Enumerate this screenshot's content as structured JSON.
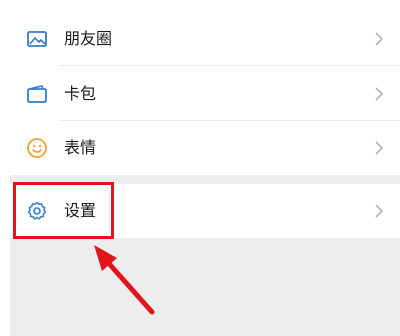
{
  "menu": {
    "items": [
      {
        "label": "朋友圈",
        "icon": "photo-album-icon"
      },
      {
        "label": "卡包",
        "icon": "card-wallet-icon"
      },
      {
        "label": "表情",
        "icon": "smiley-face-icon"
      },
      {
        "label": "设置",
        "icon": "gear-icon"
      }
    ]
  },
  "colors": {
    "accent_icon": "#2f7dd1",
    "smiley_icon": "#f3a22d",
    "highlight": "#e0161c",
    "background": "#ededed"
  }
}
